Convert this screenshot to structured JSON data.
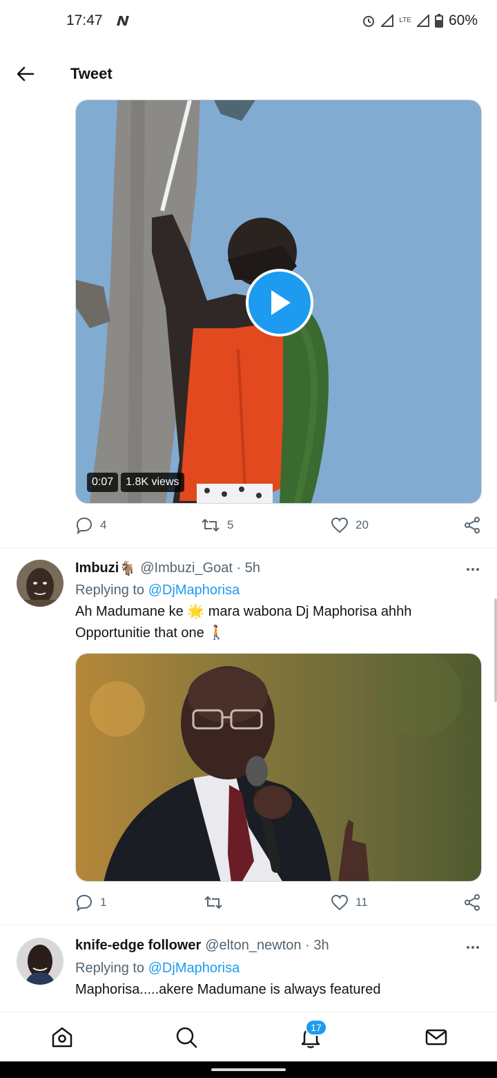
{
  "status_bar": {
    "time": "17:47",
    "network": "LTE",
    "battery": "60%"
  },
  "header": {
    "title": "Tweet",
    "back_icon": "arrow-left-icon"
  },
  "main_tweet": {
    "video": {
      "duration": "0:07",
      "views": "1.8K views",
      "play_icon": "play-icon"
    },
    "actions": {
      "replies": "4",
      "retweets": "5",
      "likes": "20"
    }
  },
  "replies": [
    {
      "name": "Imbuzi",
      "name_emoji": "🐐",
      "handle": "@Imbuzi_Goat",
      "time": "5h",
      "replying_prefix": "Replying to",
      "replying_to": "@DjMaphorisa",
      "text_line1": "Ah Madumane ke 🌟 mara wabona Dj Maphorisa ahhh",
      "text_line2": "Opportunitie that one 🚶",
      "actions": {
        "replies": "1",
        "retweets": "",
        "likes": "11"
      }
    },
    {
      "name": "knife-edge follower",
      "handle": "@elton_newton",
      "time": "3h",
      "replying_prefix": "Replying to",
      "replying_to": "@DjMaphorisa",
      "text_line1": "Maphorisa.....akere Madumane is always featured"
    }
  ],
  "bottom_nav": {
    "notifications_count": "17",
    "items": [
      "home-icon",
      "search-icon",
      "notifications-icon",
      "messages-icon"
    ]
  },
  "colors": {
    "accent": "#1d9bf0",
    "secondary_text": "#536471",
    "primary_text": "#0f1419"
  }
}
